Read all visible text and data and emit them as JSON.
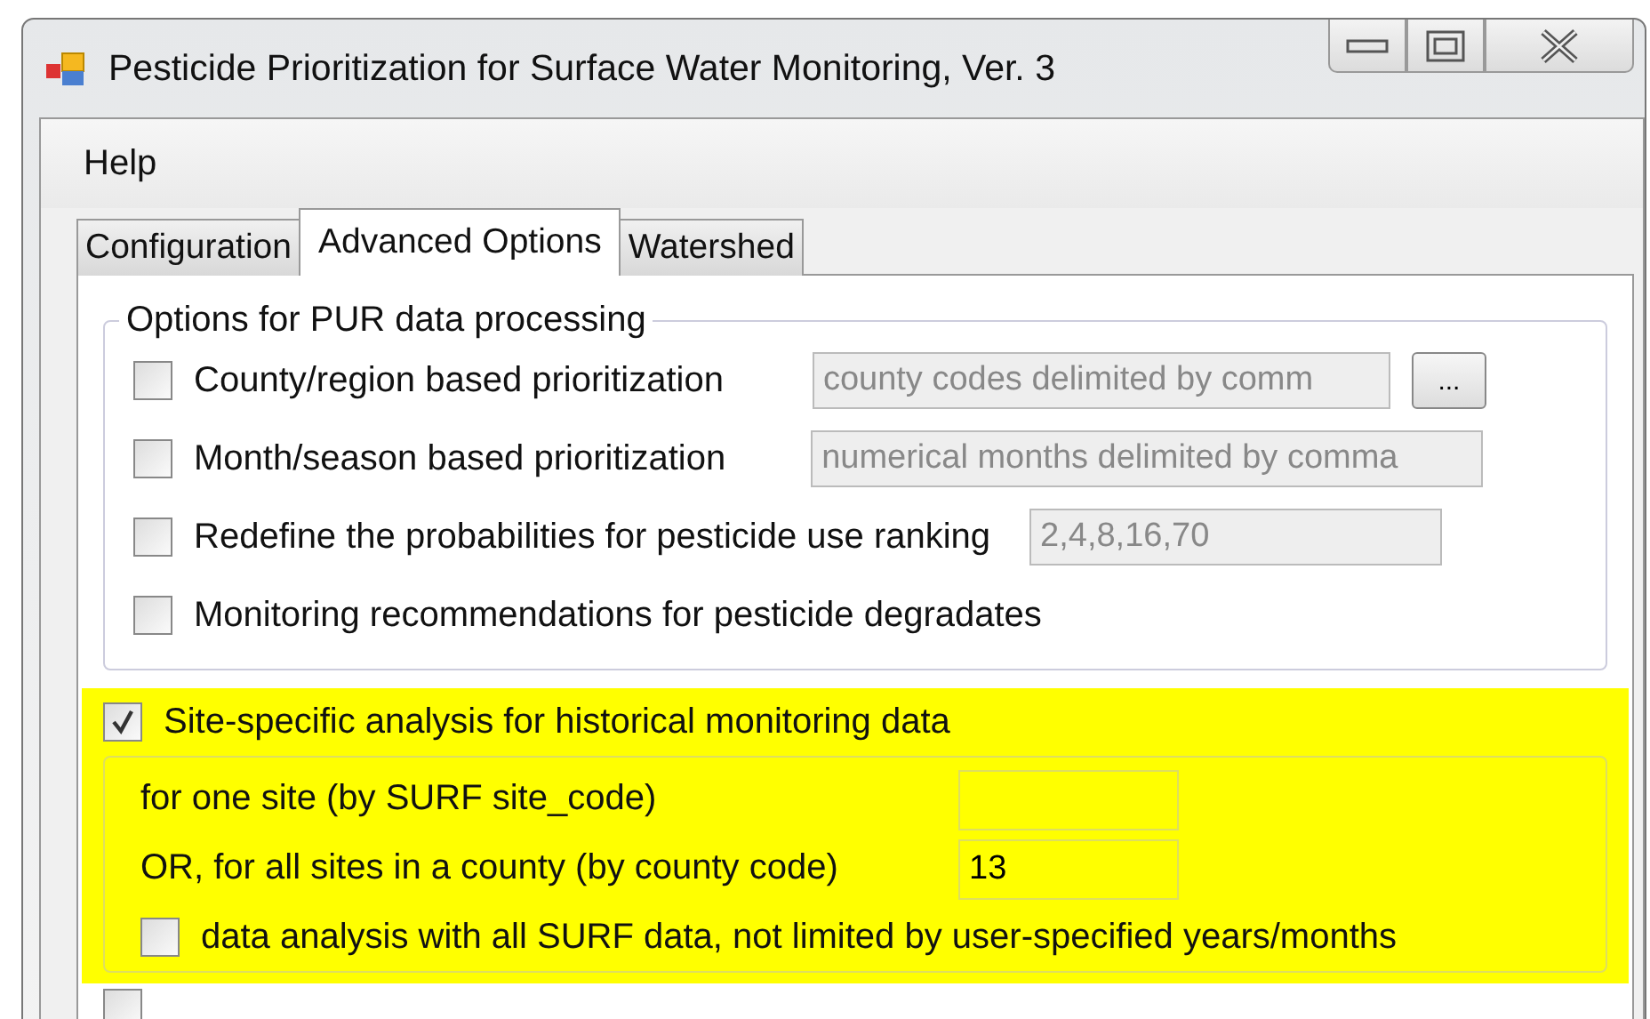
{
  "window": {
    "title": "Pesticide Prioritization for Surface Water Monitoring, Ver. 3"
  },
  "menu": [
    "Help"
  ],
  "tabs": [
    {
      "label": "Configuration",
      "selected": false
    },
    {
      "label": "Advanced Options",
      "selected": true
    },
    {
      "label": "Watershed",
      "selected": false
    }
  ],
  "pur_group": {
    "title": "Options for PUR data processing",
    "options": [
      {
        "label": "County/region based prioritization",
        "checked": false,
        "field": {
          "placeholder": "county codes delimited by comm",
          "disabled": true
        },
        "button": "..."
      },
      {
        "label": "Month/season based prioritization",
        "checked": false,
        "field": {
          "placeholder": "numerical months delimited by comma",
          "disabled": true
        }
      },
      {
        "label": "Redefine the probabilities for pesticide use ranking",
        "checked": false,
        "field": {
          "value": "2,4,8,16,70",
          "disabled": true
        }
      },
      {
        "label": "Monitoring recommendations for pesticide degradates",
        "checked": false
      }
    ]
  },
  "site_analysis": {
    "label": "Site-specific analysis for historical monitoring data",
    "checked": true,
    "highlighted": true,
    "fields": [
      {
        "label": "for one site (by SURF site_code)"
      },
      {
        "label": "OR, for all sites in a county (by county code)",
        "value": "13"
      }
    ],
    "all_data": {
      "label": "data analysis with all SURF data, not limited by user-specified years/months",
      "checked": false
    }
  },
  "next_row": {
    "checked": false
  }
}
